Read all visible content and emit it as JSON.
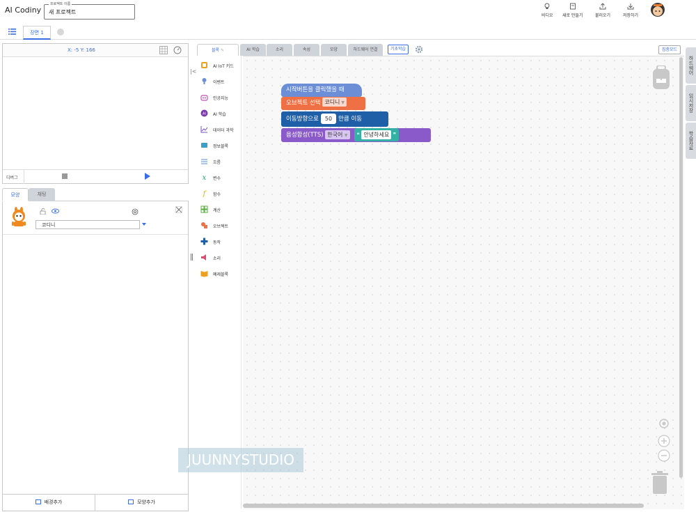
{
  "header": {
    "logo": "AI Codiny",
    "project_caption": "프로젝트 이름",
    "project_name": "새 프로젝트",
    "actions": [
      {
        "label": "비디오",
        "icon": "lightbulb-icon"
      },
      {
        "label": "새로 만들기",
        "icon": "new-file-icon"
      },
      {
        "label": "불러오기",
        "icon": "upload-icon"
      },
      {
        "label": "저장하기",
        "icon": "download-icon"
      }
    ]
  },
  "scene": {
    "tab_label": "장면 1"
  },
  "stage": {
    "coords": "X: -5 Y: 166",
    "debug_label": "디버그"
  },
  "object_tabs": {
    "shape": "모양",
    "chat": "채팅"
  },
  "object": {
    "name": "코디니"
  },
  "object_buttons": {
    "add_background": "배경추가",
    "add_shape": "모양추가"
  },
  "watermark": "JUUNNYSTUDIO",
  "block_tabs": [
    "블록",
    "AI 학습",
    "소리",
    "속성",
    "모양",
    "하드웨어 연결"
  ],
  "basic_learning": "기초학습",
  "focus_mode": "집중모드",
  "categories": [
    {
      "label": "AI IoT 키드",
      "icon": "iot-kit-icon",
      "color": "#f0a020"
    },
    {
      "label": "이벤트",
      "icon": "event-icon",
      "color": "#6b8ed7"
    },
    {
      "label": "인공지능",
      "icon": "robot-icon",
      "color": "#c44fc0"
    },
    {
      "label": "AI 학습",
      "icon": "ai-learning-icon",
      "color": "#7a3aa8"
    },
    {
      "label": "데이터 과학",
      "icon": "data-science-icon",
      "color": "#7a4fc0"
    },
    {
      "label": "정보블록",
      "icon": "info-block-icon",
      "color": "#39a0c8"
    },
    {
      "label": "흐름",
      "icon": "flow-icon",
      "color": "#5a8fd8"
    },
    {
      "label": "변수",
      "icon": "variable-icon",
      "color": "#20a070"
    },
    {
      "label": "함수",
      "icon": "function-icon",
      "color": "#e0b000"
    },
    {
      "label": "계산",
      "icon": "calculate-icon",
      "color": "#5ab040"
    },
    {
      "label": "오브젝트",
      "icon": "object-icon",
      "color": "#f07046"
    },
    {
      "label": "동작",
      "icon": "motion-icon",
      "color": "#1e5fa8"
    },
    {
      "label": "소리",
      "icon": "sound-icon",
      "color": "#e04a70"
    },
    {
      "label": "예제블록",
      "icon": "example-block-icon",
      "color": "#f0a020"
    }
  ],
  "blocks": {
    "start": "시작버튼을 클릭했을 때",
    "select_prefix": "오브젝트 선택",
    "select_value": "코디니",
    "move_prefix": "이동방향으로",
    "move_value": "50",
    "move_suffix": "만큼 이동",
    "tts_prefix": "음성합성(TTS)",
    "tts_lang": "한국어",
    "tts_text": "안녕하세요"
  },
  "side_tabs": [
    "하드웨어",
    "임시저장",
    "학습자료"
  ]
}
